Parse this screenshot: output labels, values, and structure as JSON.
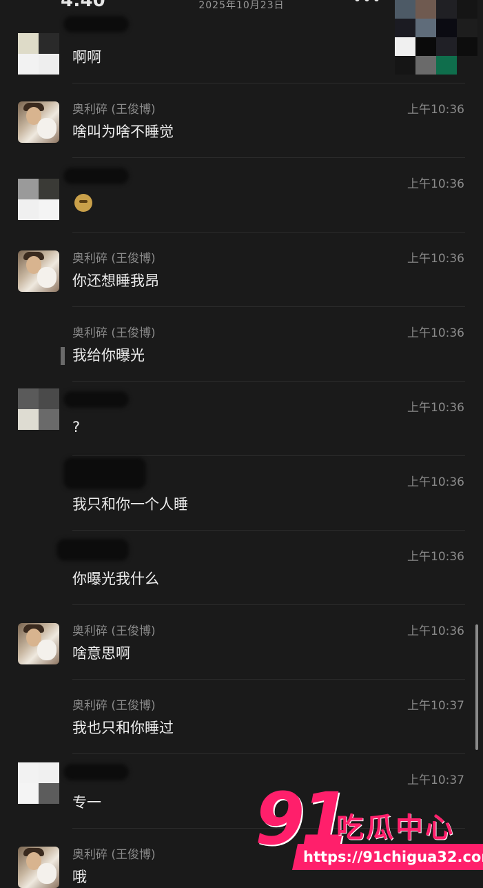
{
  "status_bar": {
    "time": "4:40",
    "date": "2025年10月23日",
    "signal": "•••"
  },
  "messages": [
    {
      "sender": "",
      "time": "",
      "text": "啊啊",
      "avatar": "mosaic-a"
    },
    {
      "sender": "奥利碎 (王俊博)",
      "time": "上午10:36",
      "text": "啥叫为啥不睡觉",
      "avatar": "photo"
    },
    {
      "sender": "",
      "time": "上午10:36",
      "text": "",
      "emoji": "emoji-face",
      "avatar": "mosaic-b"
    },
    {
      "sender": "奥利碎 (王俊博)",
      "time": "上午10:36",
      "text": "你还想睡我昂",
      "avatar": "photo"
    },
    {
      "sender": "奥利碎 (王俊博)",
      "time": "上午10:36",
      "text": "我给你曝光",
      "avatar": "none"
    },
    {
      "sender": "",
      "time": "上午10:36",
      "text": "?",
      "avatar": "mosaic-c"
    },
    {
      "sender": "",
      "time": "上午10:36",
      "text": "我只和你一个人睡",
      "avatar": "none"
    },
    {
      "sender": "",
      "time": "上午10:36",
      "text": "你曝光我什么",
      "avatar": "none"
    },
    {
      "sender": "奥利碎 (王俊博)",
      "time": "上午10:36",
      "text": "啥意思啊",
      "avatar": "photo"
    },
    {
      "sender": "奥利碎 (王俊博)",
      "time": "上午10:37",
      "text": "我也只和你睡过",
      "avatar": "none"
    },
    {
      "sender": "",
      "time": "上午10:37",
      "text": "专一",
      "avatar": "mosaic-d"
    },
    {
      "sender": "奥利碎 (王俊博)",
      "time": "",
      "text": "哦",
      "avatar": "photo"
    }
  ],
  "watermark": {
    "number": "91",
    "brand": "吃瓜中心",
    "url": "https://91chigua32.com"
  },
  "colors": {
    "background": "#1a1a1a",
    "accent": "#ff1f6b"
  }
}
